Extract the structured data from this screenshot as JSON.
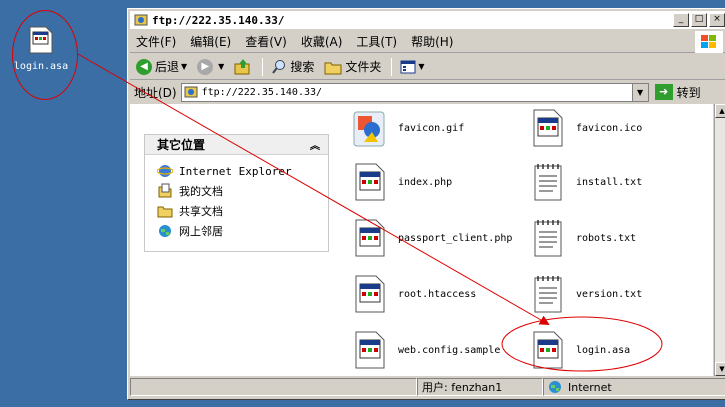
{
  "desktop": {
    "icon_label": "login.asa"
  },
  "window": {
    "title": "ftp://222.35.140.33/",
    "controls": {
      "minimize": "_",
      "maximize": "□",
      "close": "×"
    }
  },
  "menubar": {
    "items": [
      "文件(F)",
      "编辑(E)",
      "查看(V)",
      "收藏(A)",
      "工具(T)",
      "帮助(H)"
    ]
  },
  "toolbar": {
    "back": "后退",
    "search": "搜索",
    "folders": "文件夹"
  },
  "address": {
    "label": "地址(D)",
    "value": "ftp://222.35.140.33/",
    "go_label": "转到"
  },
  "other_places": {
    "title": "其它位置",
    "items": [
      "Internet Explorer",
      "我的文档",
      "共享文档",
      "网上邻居"
    ]
  },
  "files": [
    {
      "name": "favicon.gif",
      "icon": "image-file-icon"
    },
    {
      "name": "favicon.ico",
      "icon": "ico-file-icon"
    },
    {
      "name": "index.php",
      "icon": "app-file-icon"
    },
    {
      "name": "install.txt",
      "icon": "text-file-icon"
    },
    {
      "name": "passport_client.php",
      "icon": "app-file-icon"
    },
    {
      "name": "robots.txt",
      "icon": "text-file-icon"
    },
    {
      "name": "root.htaccess",
      "icon": "app-file-icon"
    },
    {
      "name": "version.txt",
      "icon": "text-file-icon"
    },
    {
      "name": "web.config.sample",
      "icon": "app-file-icon"
    },
    {
      "name": "login.asa",
      "icon": "app-file-icon"
    }
  ],
  "status": {
    "user": "用户: fenzhan1",
    "zone": "Internet"
  },
  "colors": {
    "annotation": "#dd0000",
    "desktop": "#3a6ea5"
  }
}
